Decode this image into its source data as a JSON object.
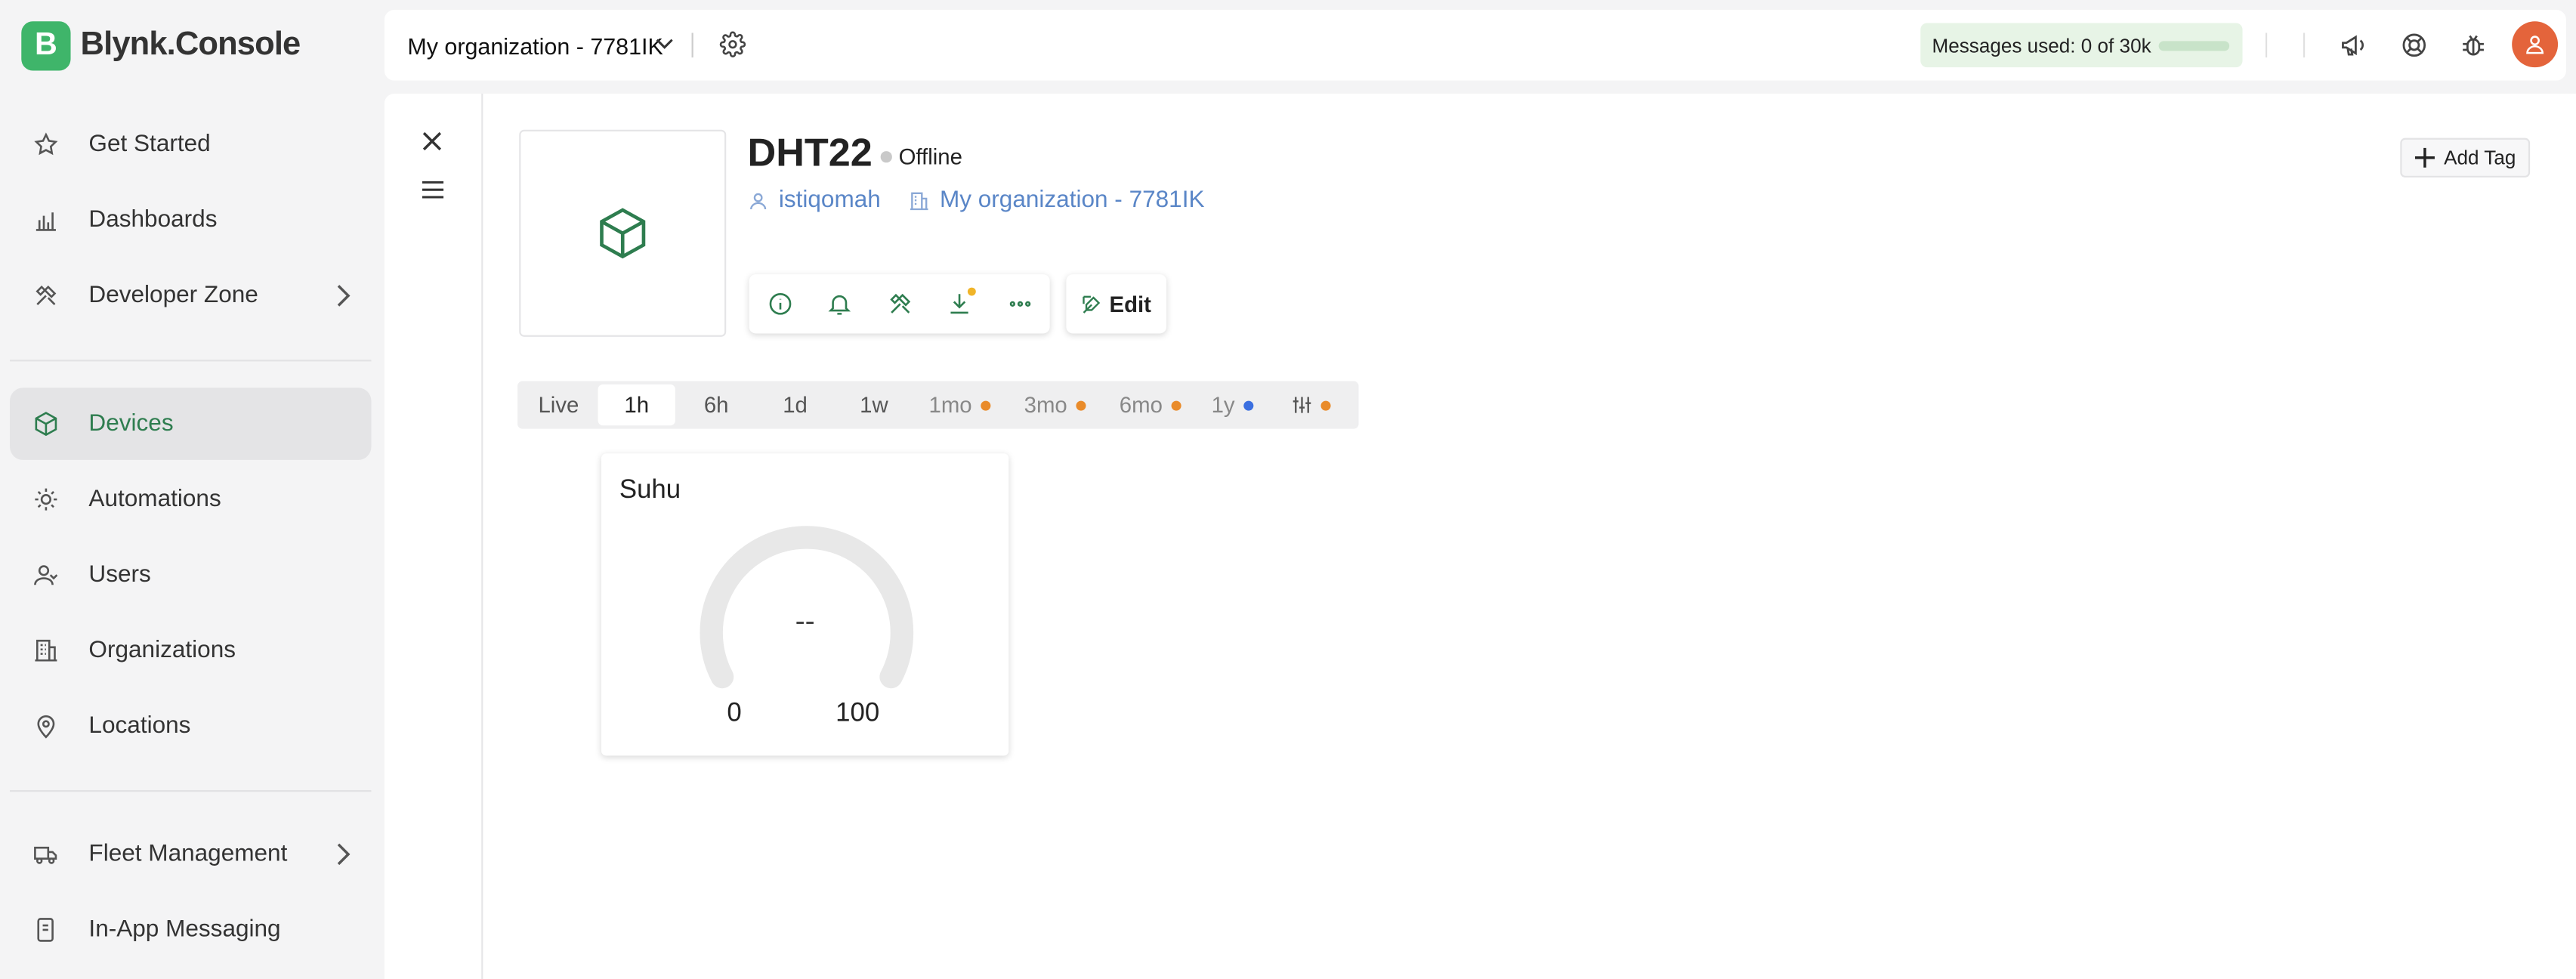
{
  "app": {
    "logo_letter": "B",
    "name": "Blynk.Console"
  },
  "sidebar": {
    "items": [
      {
        "label": "Get Started",
        "icon": "star-icon"
      },
      {
        "label": "Dashboards",
        "icon": "bar-chart-icon"
      },
      {
        "label": "Developer Zone",
        "icon": "tools-icon",
        "has_chevron": true
      },
      {
        "label": "Devices",
        "icon": "cube-icon",
        "active": true
      },
      {
        "label": "Automations",
        "icon": "automation-icon"
      },
      {
        "label": "Users",
        "icon": "users-icon"
      },
      {
        "label": "Organizations",
        "icon": "building-icon"
      },
      {
        "label": "Locations",
        "icon": "location-pin-icon"
      },
      {
        "label": "Fleet Management",
        "icon": "truck-icon",
        "has_chevron": true
      },
      {
        "label": "In-App Messaging",
        "icon": "messaging-icon"
      }
    ]
  },
  "header": {
    "org": "My organization - 7781IK",
    "messages_label": "Messages used: 0 of 30k",
    "messages_used_fraction": 0
  },
  "device": {
    "name": "DHT22",
    "status": "Offline",
    "owner": "istiqomah",
    "organization": "My organization - 7781IK",
    "edit_label": "Edit",
    "add_tag_label": "Add Tag"
  },
  "time_ranges": [
    {
      "label": "Live"
    },
    {
      "label": "1h",
      "selected": true
    },
    {
      "label": "6h"
    },
    {
      "label": "1d"
    },
    {
      "label": "1w"
    },
    {
      "label": "1mo",
      "dot": "#e98b2a"
    },
    {
      "label": "3mo",
      "dot": "#e98b2a"
    },
    {
      "label": "6mo",
      "dot": "#e98b2a"
    },
    {
      "label": "1y",
      "dot": "#3b6fe0"
    }
  ],
  "custom_range_dot": "#e98b2a",
  "widget": {
    "title": "Suhu",
    "value": "--",
    "min": "0",
    "max": "100"
  },
  "colors": {
    "brand_green": "#3fb56a",
    "active_green": "#2e7d4f",
    "link_blue": "#5a86c7",
    "notification_dot": "#f0b429",
    "avatar": "#e4643b"
  }
}
